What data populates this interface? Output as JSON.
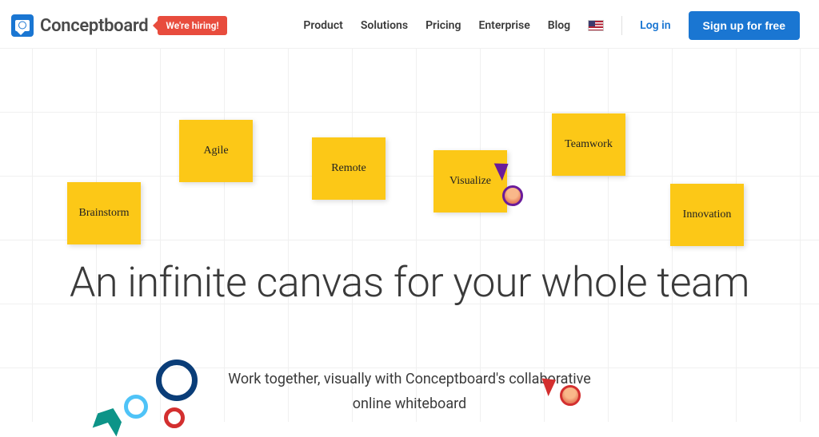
{
  "header": {
    "logo_text": "Conceptboard",
    "hiring_badge": "We're hiring!",
    "nav": {
      "product": "Product",
      "solutions": "Solutions",
      "pricing": "Pricing",
      "enterprise": "Enterprise",
      "blog": "Blog"
    },
    "login": "Log in",
    "signup": "Sign up for free"
  },
  "stickies": {
    "brainstorm": "Brainstorm",
    "agile": "Agile",
    "remote": "Remote",
    "visualize": "Visualize",
    "teamwork": "Teamwork",
    "innovation": "Innovation"
  },
  "hero": {
    "title": "An infinite canvas for your whole team",
    "subtitle": "Work together, visually with Conceptboard's collaborative online whiteboard"
  }
}
